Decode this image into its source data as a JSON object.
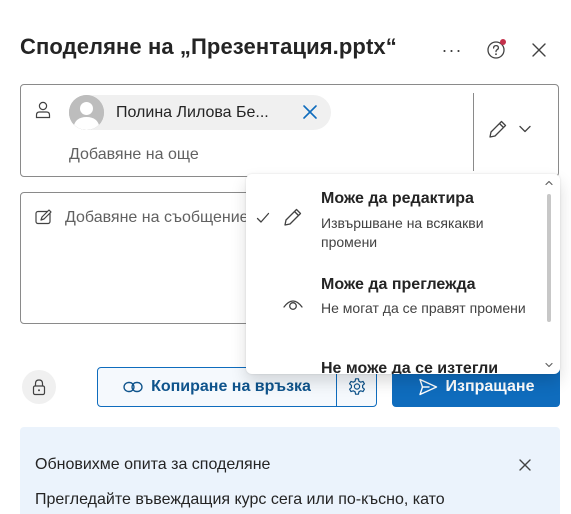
{
  "dialog": {
    "title": "Споделяне на „Презентация.pptx“",
    "more_label": "···"
  },
  "recipients": {
    "chips": [
      {
        "name": "Полина Лилова Бе..."
      }
    ],
    "add_more_placeholder": "Добавяне на още"
  },
  "message": {
    "placeholder": "Добавяне на съобщение"
  },
  "permission_menu": {
    "options": [
      {
        "title": "Може да редактира",
        "description": "Извършване на всякакви промени",
        "icon": "pencil-icon",
        "selected": true
      },
      {
        "title": "Може да преглежда",
        "description": "Не могат да се правят промени",
        "icon": "eye-icon",
        "selected": false
      },
      {
        "title": "Не може да се изтегли",
        "description": "",
        "icon": "no-download-icon",
        "selected": false
      }
    ]
  },
  "actions": {
    "copy_link_label": "Копиране на връзка",
    "send_label": "Изпращане"
  },
  "notice": {
    "title": "Обновихме опита за споделяне",
    "body": "Прегледайте въвеждащия курс сега или по-късно, като"
  },
  "colors": {
    "accent": "#0f6cbd",
    "notice_bg": "#ebf3fc",
    "notification_dot": "#c4314b"
  }
}
